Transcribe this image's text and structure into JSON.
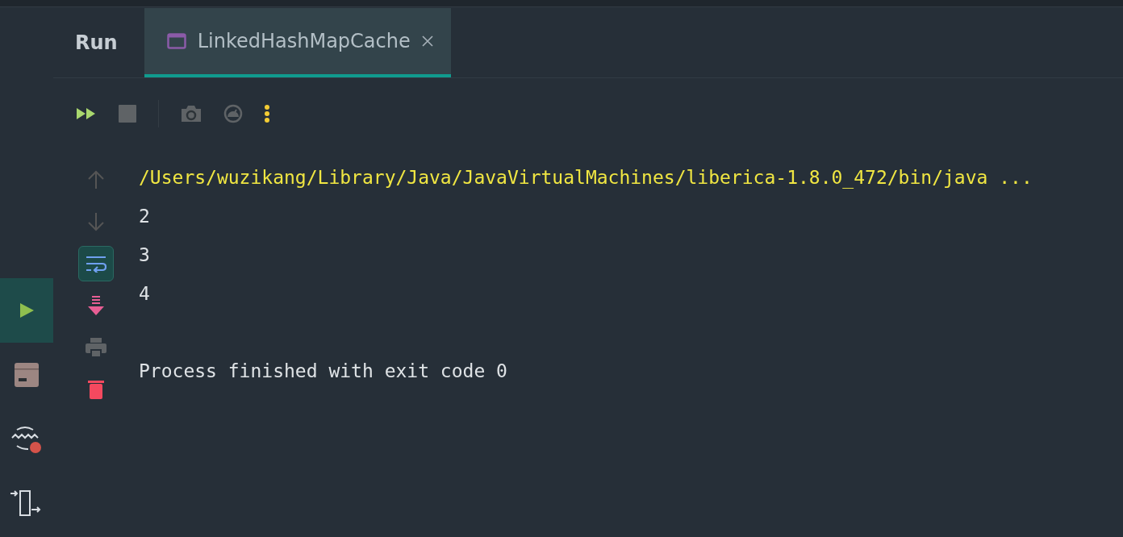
{
  "panel": {
    "title": "Run"
  },
  "tabs": [
    {
      "label": "LinkedHashMapCache",
      "selected": true
    }
  ],
  "tool_strip": [
    {
      "kind": "run",
      "selected": true
    },
    {
      "kind": "box",
      "selected": false
    },
    {
      "kind": "wave",
      "selected": false
    },
    {
      "kind": "export",
      "selected": false
    }
  ],
  "toolbar": [
    {
      "kind": "rerun"
    },
    {
      "kind": "stop"
    },
    {
      "kind": "separator"
    },
    {
      "kind": "camera"
    },
    {
      "kind": "gauge"
    },
    {
      "kind": "more"
    }
  ],
  "side_toolbar": [
    {
      "kind": "up",
      "disabled": true,
      "selected": false
    },
    {
      "kind": "down",
      "disabled": true,
      "selected": false
    },
    {
      "kind": "wrap",
      "disabled": false,
      "selected": true
    },
    {
      "kind": "scroll-end",
      "disabled": false,
      "selected": false
    },
    {
      "kind": "print",
      "disabled": false,
      "selected": false
    },
    {
      "kind": "clear",
      "disabled": false,
      "selected": false
    }
  ],
  "console": [
    {
      "kind": "command",
      "text": "/Users/wuzikang/Library/Java/JavaVirtualMachines/liberica-1.8.0_472/bin/java ..."
    },
    {
      "kind": "output",
      "text": "2"
    },
    {
      "kind": "output",
      "text": "3"
    },
    {
      "kind": "output",
      "text": "4"
    },
    {
      "kind": "status",
      "text": "Process finished with exit code 0"
    }
  ]
}
